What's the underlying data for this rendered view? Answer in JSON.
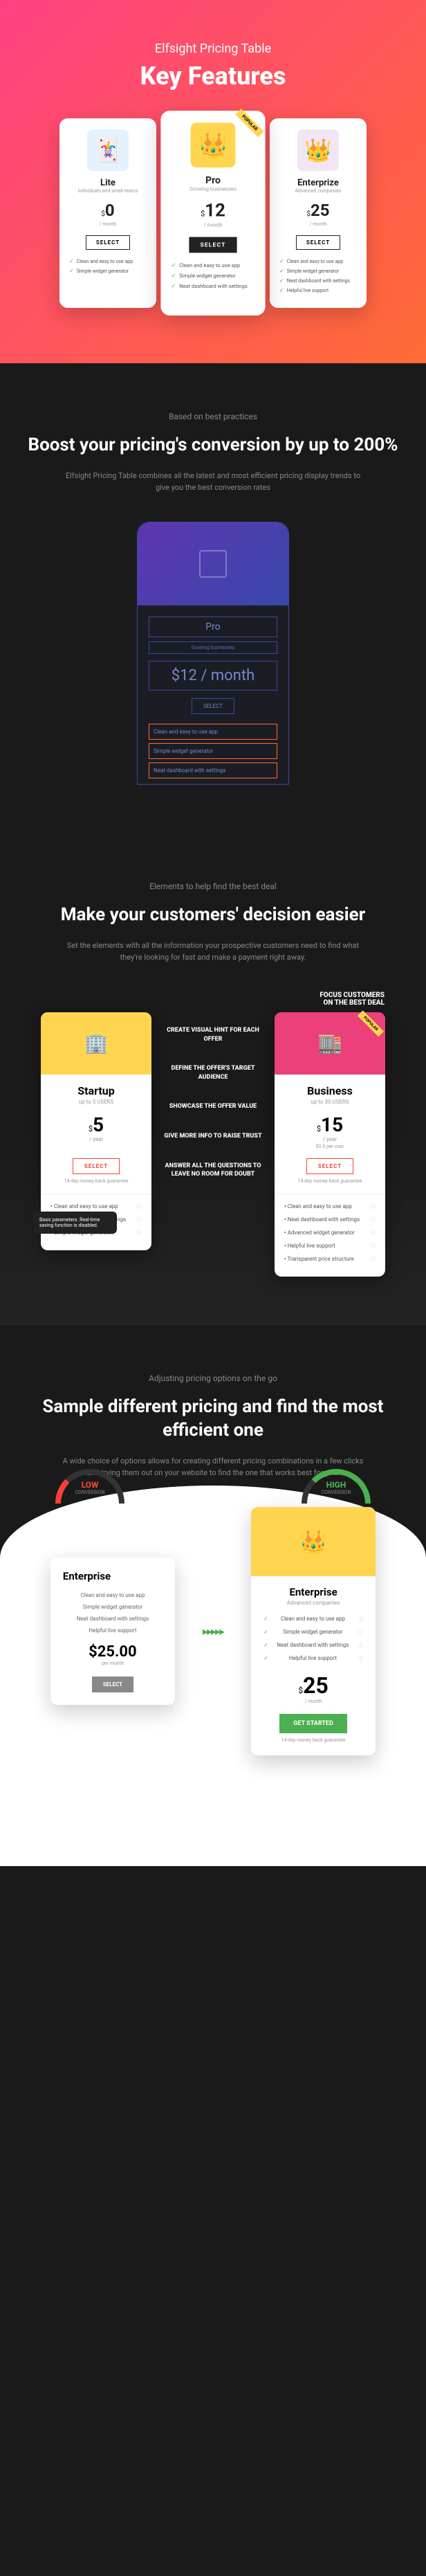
{
  "hero": {
    "subtitle": "Elfsight Pricing Table",
    "title": "Key Features",
    "plans": [
      {
        "name": "Lite",
        "sub": "Individuals and small teams",
        "cur": "$",
        "amt": "0",
        "period": "/ month",
        "btn": "SELECT",
        "features": [
          "Clean and easy to use app",
          "Simple widget generator"
        ]
      },
      {
        "name": "Pro",
        "sub": "Growing businesses",
        "cur": "$",
        "amt": "12",
        "period": "/ month",
        "btn": "SELECT",
        "badge": "POPULAR",
        "features": [
          "Clean and easy to use app",
          "Simple widget generator",
          "Neat dashboard with settings"
        ]
      },
      {
        "name": "Enterprize",
        "sub": "Advanced companies",
        "cur": "$",
        "amt": "25",
        "period": "/ month",
        "btn": "SELECT",
        "features": [
          "Clean and easy to use app",
          "Simple widget generator",
          "Neat dashboard with settings",
          "Helpful live support"
        ]
      }
    ]
  },
  "sec2": {
    "eyebrow": "Based on best practices",
    "title": "Boost your pricing's conversion by up to 200%",
    "desc": "Elfsight Pricing Table combines all the latest and most efficient pricing display trends to give you the best conversion rates",
    "wf": {
      "name": "Pro",
      "sub": "Growing businesses",
      "price": "$12 / month",
      "btn": "SELECT",
      "feats": [
        "Clean and easy to use app",
        "Simple widget generator",
        "Neat dashboard with settings"
      ]
    }
  },
  "sec3": {
    "eyebrow": "Elements to help find the best deal",
    "title": "Make your customers' decision easier",
    "desc": "Set the elements with all the information your prospective customers need to find what they're looking for fast and make a payment right away.",
    "focus": "FOCUS CUSTOMERS\nON THE BEST DEAL",
    "annots": [
      "CREATE VISUAL HINT FOR EACH OFFER",
      "DEFINE THE OFFER'S TARGET AUDIENCE",
      "SHOWCASE THE OFFER VALUE",
      "GIVE MORE INFO TO RAISE TRUST",
      "ANSWER ALL THE QUESTIONS TO LEAVE NO ROOM FOR DOUBT"
    ],
    "startup": {
      "name": "Startup",
      "sub": "up to 5 USERS",
      "cur": "$",
      "amt": "5",
      "per": "/ year",
      "btn": "SELECT",
      "guar": "14-day money back guarantee",
      "feats": [
        "Clean and easy to use app",
        "Neat dashboard with settings",
        "Simple widget generator"
      ],
      "tooltip": "Basic parameters. Real-time saving function is disabled."
    },
    "biz": {
      "name": "Business",
      "sub": "up to 30 USERS",
      "cur": "$",
      "amt": "15",
      "per": "/ year",
      "extra": "$0.5 per user",
      "btn": "SELECT",
      "guar": "14-day money back guarantee",
      "badge": "POPULAR",
      "feats": [
        "Clean and easy to use app",
        "Neat dashboard with settings",
        "Advanced widget generator",
        "Helpful live support",
        "Transparent price structure"
      ]
    }
  },
  "sec4": {
    "eyebrow": "Adjusting pricing options on the go",
    "title": "Sample different pricing and find the most efficient one",
    "desc": "A wide choice of options allows for creating different pricing combinations in a few clicks and trying them out on your website to find the one that works best for you.",
    "low": {
      "label": "LOW",
      "sublabel": "CONVERSION",
      "name": "Enterprise",
      "feats": [
        "Clean and easy to use app",
        "Simple widget generator",
        "Neat dashboard with settings",
        "Helpful live support"
      ],
      "price": "$25.00",
      "per": "per month",
      "btn": "SELECT"
    },
    "high": {
      "label": "HIGH",
      "sublabel": "CONVERSION",
      "name": "Enterprise",
      "sub": "Advanced companies",
      "feats": [
        "Clean and easy to use app",
        "Simple widget generator",
        "Neat dashboard with settings",
        "Helpful live support"
      ],
      "cur": "$",
      "amt": "25",
      "per": "/ month",
      "btn": "GET STARTED",
      "guar": "14-day money back guarantee"
    }
  }
}
